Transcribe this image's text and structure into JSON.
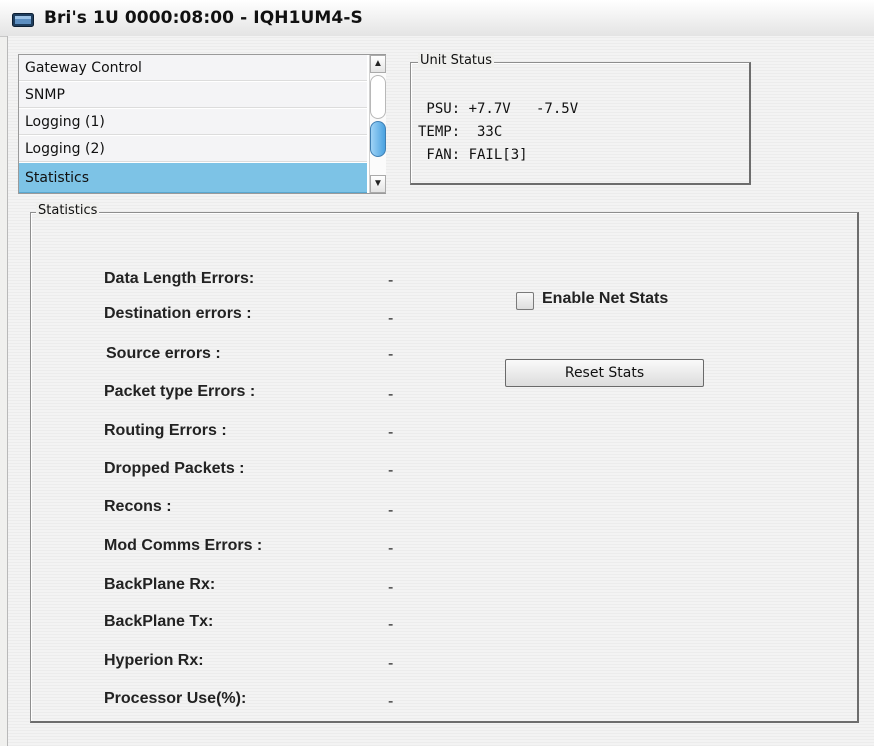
{
  "window": {
    "title": "Bri's 1U  0000:08:00  - IQH1UM4-S",
    "icon": "monitor-icon"
  },
  "nav": {
    "items": [
      {
        "label": "Gateway Control",
        "selected": false
      },
      {
        "label": "SNMP",
        "selected": false
      },
      {
        "label": "Logging (1)",
        "selected": false
      },
      {
        "label": "Logging (2)",
        "selected": false
      },
      {
        "label": "Statistics",
        "selected": true
      }
    ],
    "scroll_up": "▲",
    "scroll_down": "▼"
  },
  "unit_status": {
    "legend": "Unit Status",
    "psu_line": " PSU: +7.7V   -7.5V",
    "temp_line": "TEMP:  33C",
    "fan_line": " FAN: FAIL[3]"
  },
  "statistics": {
    "legend": "Statistics",
    "rows": [
      {
        "label": "Data Length Errors:",
        "value": "-"
      },
      {
        "label": "Destination errors :",
        "value": "-"
      },
      {
        "label": "Source errors :",
        "value": "-"
      },
      {
        "label": "Packet type Errors :",
        "value": "-"
      },
      {
        "label": "Routing Errors :",
        "value": "-"
      },
      {
        "label": "Dropped Packets :",
        "value": "-"
      },
      {
        "label": "Recons :",
        "value": "-"
      },
      {
        "label": "Mod Comms Errors :",
        "value": "-"
      },
      {
        "label": "BackPlane Rx:",
        "value": "-"
      },
      {
        "label": "BackPlane Tx:",
        "value": "-"
      },
      {
        "label": "Hyperion  Rx:",
        "value": "-"
      },
      {
        "label": "Processor Use(%):",
        "value": "-"
      }
    ],
    "enable_net_stats_label": "Enable Net Stats",
    "enable_net_stats_checked": false,
    "reset_label": "Reset Stats"
  },
  "colors": {
    "selected_row": "#7dc3e6",
    "scroll_thumb": "#4aa2e0"
  }
}
